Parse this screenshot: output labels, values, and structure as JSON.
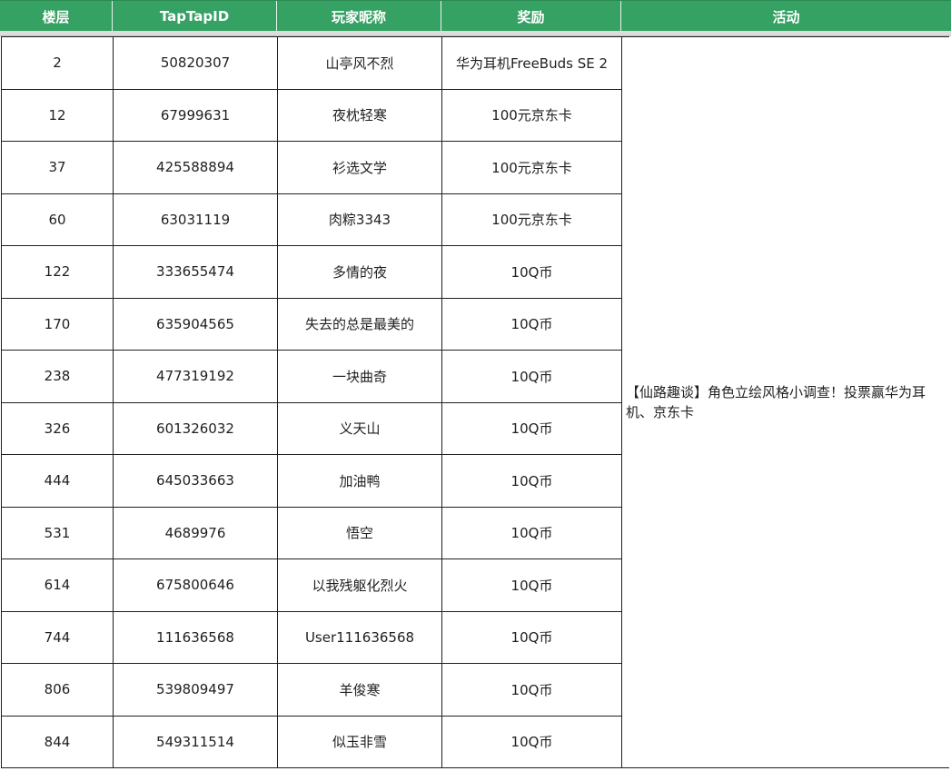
{
  "headers": {
    "floor": "楼层",
    "taptap_id": "TapTapID",
    "nickname": "玩家昵称",
    "reward": "奖励",
    "activity": "活动"
  },
  "activity_text": "【仙路趣谈】角色立绘风格小调查！投票赢华为耳机、京东卡",
  "rows": [
    {
      "floor": "2",
      "id": "50820307",
      "nickname": "山亭风不烈",
      "reward": "华为耳机FreeBuds SE 2"
    },
    {
      "floor": "12",
      "id": "67999631",
      "nickname": "夜枕轻寒",
      "reward": "100元京东卡"
    },
    {
      "floor": "37",
      "id": "425588894",
      "nickname": "衫选文学",
      "reward": "100元京东卡"
    },
    {
      "floor": "60",
      "id": "63031119",
      "nickname": "肉粽3343",
      "reward": "100元京东卡"
    },
    {
      "floor": "122",
      "id": "333655474",
      "nickname": "多情的夜",
      "reward": "10Q币"
    },
    {
      "floor": "170",
      "id": "635904565",
      "nickname": "失去的总是最美的",
      "reward": "10Q币"
    },
    {
      "floor": "238",
      "id": "477319192",
      "nickname": "一块曲奇",
      "reward": "10Q币"
    },
    {
      "floor": "326",
      "id": "601326032",
      "nickname": "义天山",
      "reward": "10Q币"
    },
    {
      "floor": "444",
      "id": "645033663",
      "nickname": "加油鸭",
      "reward": "10Q币"
    },
    {
      "floor": "531",
      "id": "4689976",
      "nickname": "悟空",
      "reward": "10Q币"
    },
    {
      "floor": "614",
      "id": "675800646",
      "nickname": "以我残躯化烈火",
      "reward": "10Q币"
    },
    {
      "floor": "744",
      "id": "111636568",
      "nickname": "User111636568",
      "reward": "10Q币"
    },
    {
      "floor": "806",
      "id": "539809497",
      "nickname": "羊俊寒",
      "reward": "10Q币"
    },
    {
      "floor": "844",
      "id": "549311514",
      "nickname": "似玉非雪",
      "reward": "10Q币"
    }
  ],
  "colors": {
    "header_bg": "#35a163",
    "header_text": "#ffffff",
    "grid_line": "#1f1f1f"
  }
}
